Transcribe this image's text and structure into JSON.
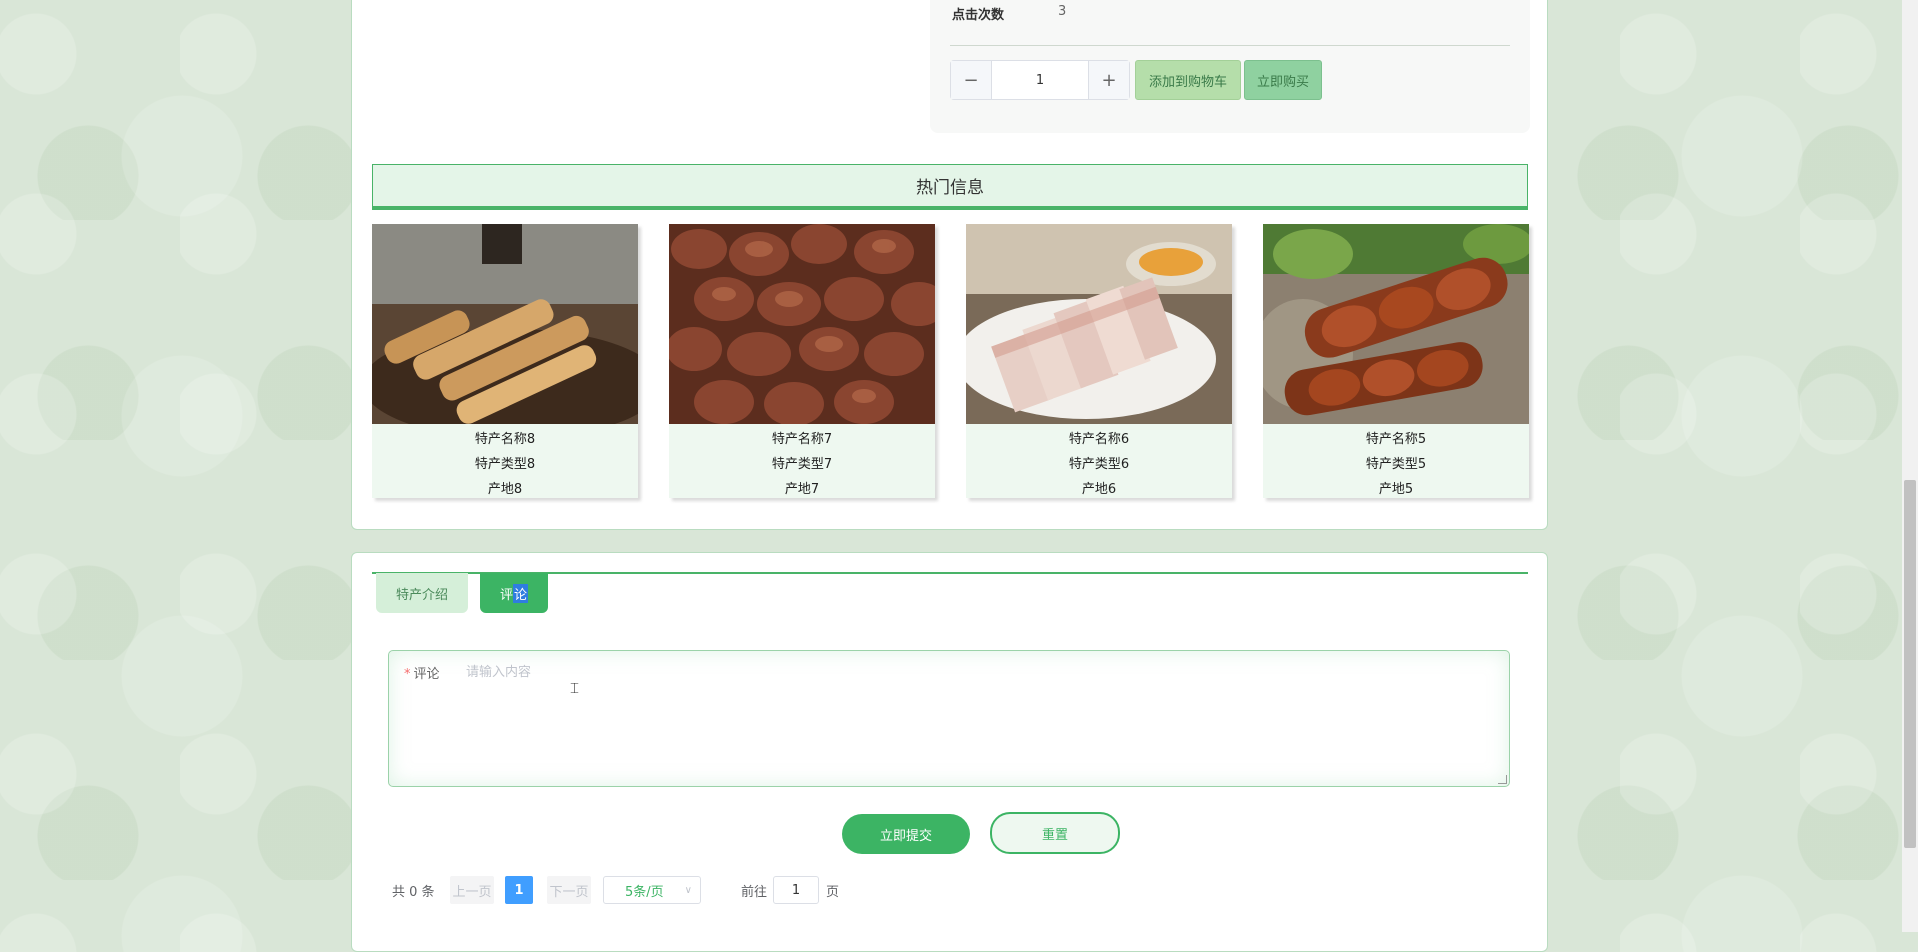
{
  "product": {
    "click_label": "点击次数",
    "click_value": "3",
    "quantity": "1",
    "minus_symbol": "−",
    "plus_symbol": "+",
    "add_to_cart": "添加到购物车",
    "buy_now": "立即购买"
  },
  "hot": {
    "title": "热门信息",
    "items": [
      {
        "name": "特产名称8",
        "type": "特产类型8",
        "origin": "产地8",
        "image": "sesame-candy-sticks"
      },
      {
        "name": "特产名称7",
        "type": "特产类型7",
        "origin": "产地7",
        "image": "pecan-nuts"
      },
      {
        "name": "特产名称6",
        "type": "特产类型6",
        "origin": "产地6",
        "image": "sliced-pork-jelly"
      },
      {
        "name": "特产名称5",
        "type": "特产类型5",
        "origin": "产地5",
        "image": "tamarind-pods"
      }
    ]
  },
  "tabs": {
    "intro": "特产介绍",
    "comment_prefix": "评",
    "comment_selected": "论"
  },
  "comment_form": {
    "required_mark": "*",
    "label": "评论",
    "placeholder": "请输入内容",
    "submit": "立即提交",
    "reset": "重置"
  },
  "pagination": {
    "total": "共 0 条",
    "prev": "上一页",
    "current_page": "1",
    "next": "下一页",
    "page_size": "5条/页",
    "goto_label": "前往",
    "goto_value": "1",
    "page_suffix": "页"
  },
  "colors": {
    "accent": "#3cb464",
    "page_bg": "#d9e6d7",
    "active_page": "#409eff"
  }
}
